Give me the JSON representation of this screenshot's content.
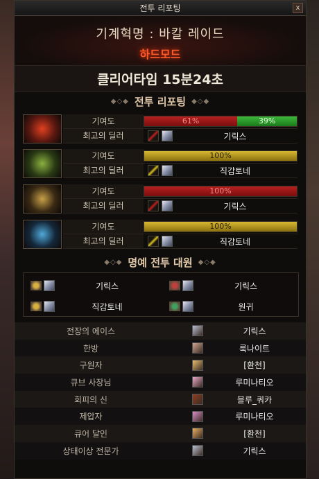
{
  "window": {
    "title": "전투 리포팅",
    "close_label": "x"
  },
  "raid": {
    "name": "기계혁명 : 바칼 레이드",
    "mode": "하드모드"
  },
  "clear_time": "클리어타임  15분24초",
  "battle_report": {
    "title": "전투 리포팅",
    "contribution_label": "기여도",
    "top_dealer_label": "최고의 딜러",
    "parties": [
      {
        "portrait": "red-dragon-portrait",
        "segments": [
          {
            "text": "61%",
            "value": 61,
            "color": "red"
          },
          {
            "text": "39%",
            "value": 39,
            "color": "green"
          }
        ],
        "dealer": "기릭스",
        "weapon_color": "#c02020"
      },
      {
        "portrait": "green-dragon-portrait",
        "segments": [
          {
            "text": "100%",
            "value": 100,
            "color": "gold"
          }
        ],
        "dealer": "직감토네",
        "weapon_color": "#d8c020"
      },
      {
        "portrait": "gold-dragon-portrait",
        "segments": [
          {
            "text": "100%",
            "value": 100,
            "color": "red"
          }
        ],
        "dealer": "기릭스",
        "weapon_color": "#c02020"
      },
      {
        "portrait": "blue-dragon-portrait",
        "segments": [
          {
            "text": "100%",
            "value": 100,
            "color": "gold"
          }
        ],
        "dealer": "직감토네",
        "weapon_color": "#d8c020"
      }
    ]
  },
  "honor": {
    "title": "명예 전투 대원",
    "members": [
      {
        "name": "기릭스",
        "medal": "gold"
      },
      {
        "name": "기릭스",
        "medal": "red"
      },
      {
        "name": "직감토네",
        "medal": "gold"
      },
      {
        "name": "원귀",
        "medal": "green"
      }
    ]
  },
  "awards": [
    {
      "title": "전장의 에이스",
      "player": "기릭스"
    },
    {
      "title": "한방",
      "player": "룩나이트"
    },
    {
      "title": "구원자",
      "player": "[환천]"
    },
    {
      "title": "큐브 사장님",
      "player": "루미나티오"
    },
    {
      "title": "회피의 신",
      "player": "블루_쿼카"
    },
    {
      "title": "제압자",
      "player": "루미나티오"
    },
    {
      "title": "큐어 달인",
      "player": "[환천]"
    },
    {
      "title": "상태이상 전문가",
      "player": "기릭스"
    }
  ]
}
